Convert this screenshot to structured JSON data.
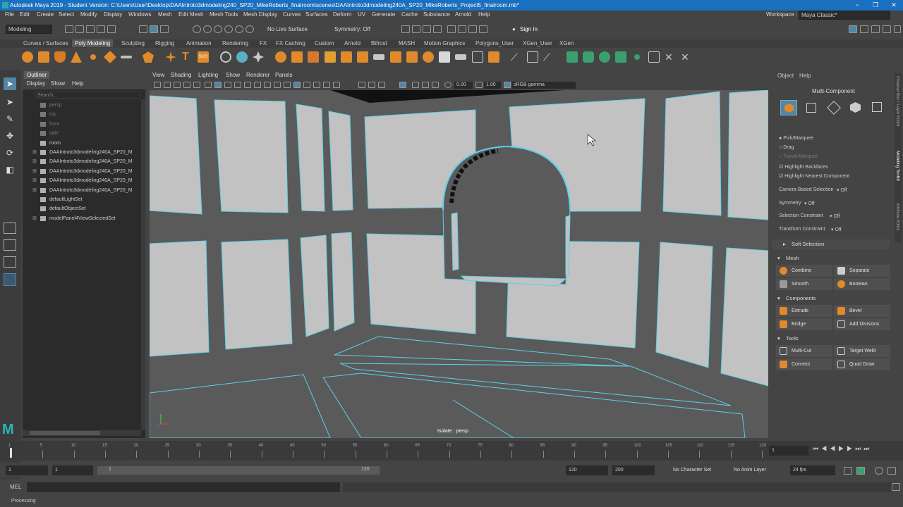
{
  "window": {
    "title": "Autodesk Maya 2019 - Student Version: C:\\Users\\User\\Desktop\\DAAIntroto3dmodeling240_SP20_MikeRoberts_finalroom\\scenes\\DAAIntroto3dmodeling240A_SP20_MikeRoberts_Project5_finalroom.mb*",
    "minimize": "−",
    "maximize": "❐",
    "close": "✕"
  },
  "menubar": {
    "items": [
      "File",
      "Edit",
      "Create",
      "Select",
      "Modify",
      "Display",
      "Windows",
      "Mesh",
      "Edit Mesh",
      "Mesh Tools",
      "Mesh Display",
      "Curves",
      "Surfaces",
      "Deform",
      "UV",
      "Generate",
      "Cache",
      "Substance",
      "Arnold",
      "Help"
    ],
    "workspace_label": "Workspace :",
    "workspace_value": "Maya Classic*"
  },
  "statusline": {
    "menuset": "Modeling",
    "live_surface": "No Live Surface",
    "symmetry": "Symmetry: Off",
    "sign_in": "Sign In"
  },
  "shelf": {
    "tabs": [
      "Curves / Surfaces",
      "Poly Modeling",
      "Sculpting",
      "Rigging",
      "Animation",
      "Rendering",
      "FX",
      "FX Caching",
      "Custom",
      "Arnold",
      "Bifrost",
      "MASH",
      "Motion Graphics",
      "Polygons_User",
      "XGen_User",
      "XGen"
    ],
    "active_tab": "Poly Modeling"
  },
  "outliner": {
    "title": "Outliner",
    "menus": [
      "Display",
      "Show",
      "Help"
    ],
    "search_placeholder": "Search...",
    "items": [
      {
        "label": "persp",
        "dim": true,
        "expand": false
      },
      {
        "label": "top",
        "dim": true,
        "expand": false
      },
      {
        "label": "front",
        "dim": true,
        "expand": false
      },
      {
        "label": "side",
        "dim": true,
        "expand": false
      },
      {
        "label": "room",
        "dim": false,
        "expand": false
      },
      {
        "label": "DAAIntroto3dmodeling240A_SP20_M",
        "dim": false,
        "expand": true
      },
      {
        "label": "DAAIntroto3dmodeling240A_SP20_M",
        "dim": false,
        "expand": true
      },
      {
        "label": "DAAIntroto3dmodeling240A_SP20_M",
        "dim": false,
        "expand": true
      },
      {
        "label": "DAAIntroto3dmodeling240A_SP20_M",
        "dim": false,
        "expand": true
      },
      {
        "label": "DAAIntroto3dmodeling240A_SP20_M",
        "dim": false,
        "expand": true
      },
      {
        "label": "defaultLightSet",
        "dim": false,
        "expand": false
      },
      {
        "label": "defaultObjectSet",
        "dim": false,
        "expand": false
      },
      {
        "label": "modelPanel4ViewSelectedSet",
        "dim": false,
        "expand": true
      }
    ]
  },
  "viewport": {
    "menus": [
      "View",
      "Shading",
      "Lighting",
      "Show",
      "Renderer",
      "Panels"
    ],
    "field_a": "0.00",
    "field_b": "1.00",
    "colorspace": "sRGB gamma",
    "camera_label": "Isolate : persp"
  },
  "right_panel": {
    "menus": [
      "Object",
      "Help"
    ],
    "mode": "Multi-Component",
    "pick": "Pick/Marquee",
    "drag": "Drag",
    "tweak": "Tweak/Marquee",
    "highlight_backfaces": "Highlight Backfaces",
    "highlight_nearest": "Highlight Nearest Component",
    "camera_based_label": "Camera Based Selection",
    "camera_based_value": "Off",
    "symmetry_label": "Symmetry",
    "symmetry_value": "Off",
    "selection_constraint_label": "Selection Constraint",
    "selection_constraint_value": "Off",
    "transform_constraint_label": "Transform Constraint",
    "transform_constraint_value": "Off",
    "soft_selection": "Soft Selection",
    "mesh_section": "Mesh",
    "combine": "Combine",
    "separate": "Separate",
    "smooth": "Smooth",
    "boolean": "Boolean",
    "components_section": "Components",
    "extrude": "Extrude",
    "bevel": "Bevel",
    "bridge": "Bridge",
    "add_divisions": "Add Divisions",
    "tools_section": "Tools",
    "multi_cut": "Multi-Cut",
    "target_weld": "Target Weld",
    "connect": "Connect",
    "quad_draw": "Quad Draw",
    "side_tabs": [
      "Channel Box / Layer Editor",
      "Modeling Toolkit",
      "Attribute Editor"
    ]
  },
  "timeline": {
    "ticks": [
      "1",
      "5",
      "10",
      "15",
      "20",
      "25",
      "30",
      "35",
      "40",
      "45",
      "50",
      "55",
      "60",
      "65",
      "70",
      "75",
      "80",
      "85",
      "90",
      "95",
      "100",
      "105",
      "110",
      "115",
      "120"
    ],
    "current_frame": "1"
  },
  "range": {
    "start": "1",
    "inner_start": "1",
    "slider_start": "1",
    "slider_end": "120",
    "inner_end": "120",
    "end": "200",
    "character_set": "No Character Set",
    "anim_layer": "No Anim Layer",
    "fps": "24 fps"
  },
  "cmdline": {
    "label": "MEL"
  },
  "helpline": {
    "text": "Processing"
  },
  "colors": {
    "accent": "#5285a6",
    "wire": "#5ad1e8",
    "titlebar": "#1a6fbf"
  }
}
